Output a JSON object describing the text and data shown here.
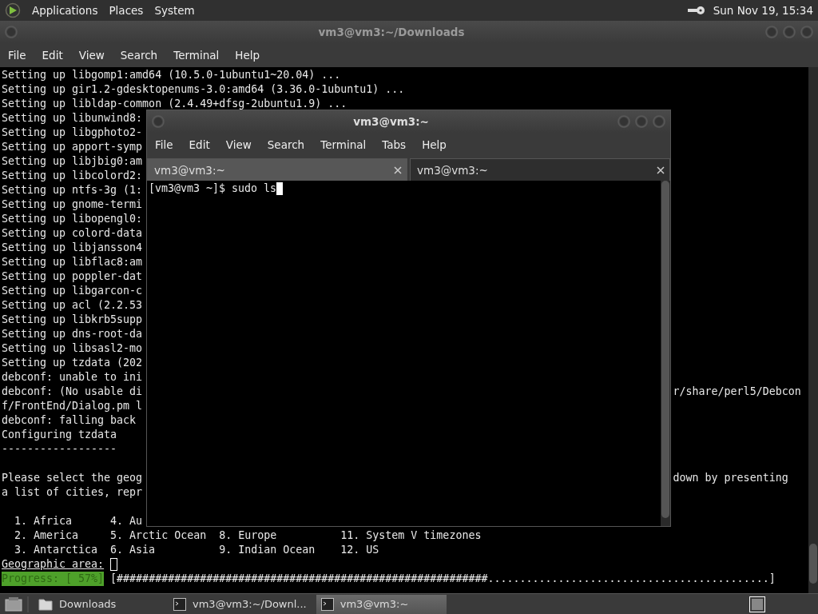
{
  "top_panel": {
    "menus": [
      "Applications",
      "Places",
      "System"
    ],
    "clock": "Sun Nov 19, 15:34"
  },
  "back_window": {
    "title": "vm3@vm3:~/Downloads",
    "menu": [
      "File",
      "Edit",
      "View",
      "Search",
      "Terminal",
      "Help"
    ],
    "lines": [
      {
        "kind": "text",
        "text": "Setting up libgomp1:amd64 (10.5.0-1ubuntu1~20.04) ..."
      },
      {
        "kind": "text",
        "text": "Setting up gir1.2-gdesktopenums-3.0:amd64 (3.36.0-1ubuntu1) ..."
      },
      {
        "kind": "text",
        "text": "Setting up libldap-common (2.4.49+dfsg-2ubuntu1.9) ..."
      },
      {
        "kind": "text",
        "text": "Setting up libunwind8:"
      },
      {
        "kind": "text",
        "text": "Setting up libgphoto2-"
      },
      {
        "kind": "text",
        "text": "Setting up apport-symp"
      },
      {
        "kind": "text",
        "text": "Setting up libjbig0:am"
      },
      {
        "kind": "text",
        "text": "Setting up libcolord2:"
      },
      {
        "kind": "text",
        "text": "Setting up ntfs-3g (1:"
      },
      {
        "kind": "text",
        "text": "Setting up gnome-termi"
      },
      {
        "kind": "text",
        "text": "Setting up libopengl0:"
      },
      {
        "kind": "text",
        "text": "Setting up colord-data"
      },
      {
        "kind": "text",
        "text": "Setting up libjansson4"
      },
      {
        "kind": "text",
        "text": "Setting up libflac8:am"
      },
      {
        "kind": "text",
        "text": "Setting up poppler-dat"
      },
      {
        "kind": "text",
        "text": "Setting up libgarcon-c"
      },
      {
        "kind": "text",
        "text": "Setting up acl (2.2.53"
      },
      {
        "kind": "text",
        "text": "Setting up libkrb5supp"
      },
      {
        "kind": "text",
        "text": "Setting up dns-root-da"
      },
      {
        "kind": "text",
        "text": "Setting up libsasl2-mo"
      },
      {
        "kind": "text",
        "text": "Setting up tzdata (202"
      },
      {
        "kind": "text",
        "text": "debconf: unable to ini"
      },
      {
        "kind": "text",
        "text": "debconf: (No usable di",
        "right": "r/share/perl5/Debcon"
      },
      {
        "kind": "text",
        "text": "f/FrontEnd/Dialog.pm l"
      },
      {
        "kind": "text",
        "text": "debconf: falling back"
      },
      {
        "kind": "text",
        "text": "Configuring tzdata"
      },
      {
        "kind": "text",
        "text": "------------------"
      },
      {
        "kind": "blank"
      },
      {
        "kind": "text",
        "text": "Please select the geog",
        "right": "down by presenting"
      },
      {
        "kind": "text",
        "text": "a list of cities, repr"
      },
      {
        "kind": "blank"
      },
      {
        "kind": "text",
        "text": "  1. Africa      4. Au"
      },
      {
        "kind": "text",
        "text": "  2. America     5. Arctic Ocean  8. Europe          11. System V timezones"
      },
      {
        "kind": "text",
        "text": "  3. Antarctica  6. Asia          9. Indian Ocean    12. US"
      }
    ],
    "prompt": "Geographic area:",
    "progress_label": "Progress: [ 57%]",
    "progress_bar": "[##########################################################............................................]"
  },
  "front_window": {
    "title": "vm3@vm3:~",
    "menu": [
      "File",
      "Edit",
      "View",
      "Search",
      "Terminal",
      "Tabs",
      "Help"
    ],
    "tabs": [
      {
        "label": "vm3@vm3:~",
        "selected": true
      },
      {
        "label": "vm3@vm3:~",
        "selected": false
      }
    ],
    "prompt": "[vm3@vm3 ~]$ sudo ls"
  },
  "taskbar": {
    "items": [
      {
        "kind": "folder",
        "label": "Downloads",
        "selected": false
      },
      {
        "kind": "terminal",
        "label": "vm3@vm3:~/Downl...",
        "selected": false
      },
      {
        "kind": "terminal",
        "label": "vm3@vm3:~",
        "selected": true
      }
    ]
  }
}
